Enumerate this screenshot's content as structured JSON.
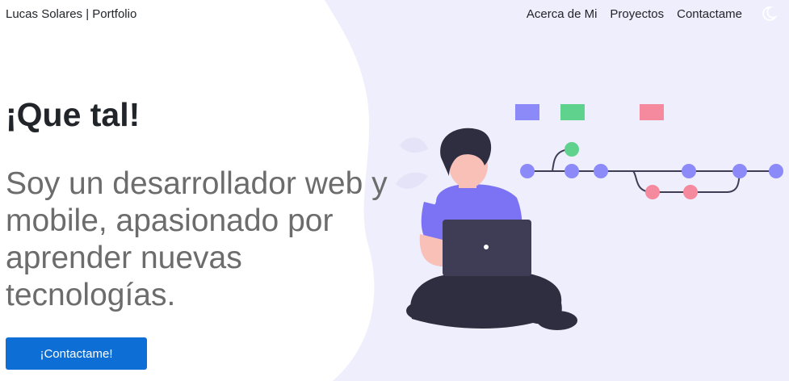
{
  "header": {
    "brand": "Lucas Solares | Portfolio",
    "nav": [
      "Acerca de Mi",
      "Proyectos",
      "Contactame"
    ],
    "theme_icon": "moon-icon"
  },
  "hero": {
    "title": "¡Que tal!",
    "subtitle": "Soy un desarrollador web y mobile, apasionado por aprender nuevas tecnologías.",
    "cta_label": "¡Contactame!"
  },
  "colors": {
    "panel_bg": "#efeefc",
    "accent": "#0d6ed6",
    "node_purple": "#8c8af8",
    "node_green": "#5fd38d",
    "node_pink": "#f5899d",
    "shirt": "#7b73f4",
    "laptop": "#3f3d56"
  },
  "illustration": "developer-sitting-with-laptop-and-git-branch-graph"
}
